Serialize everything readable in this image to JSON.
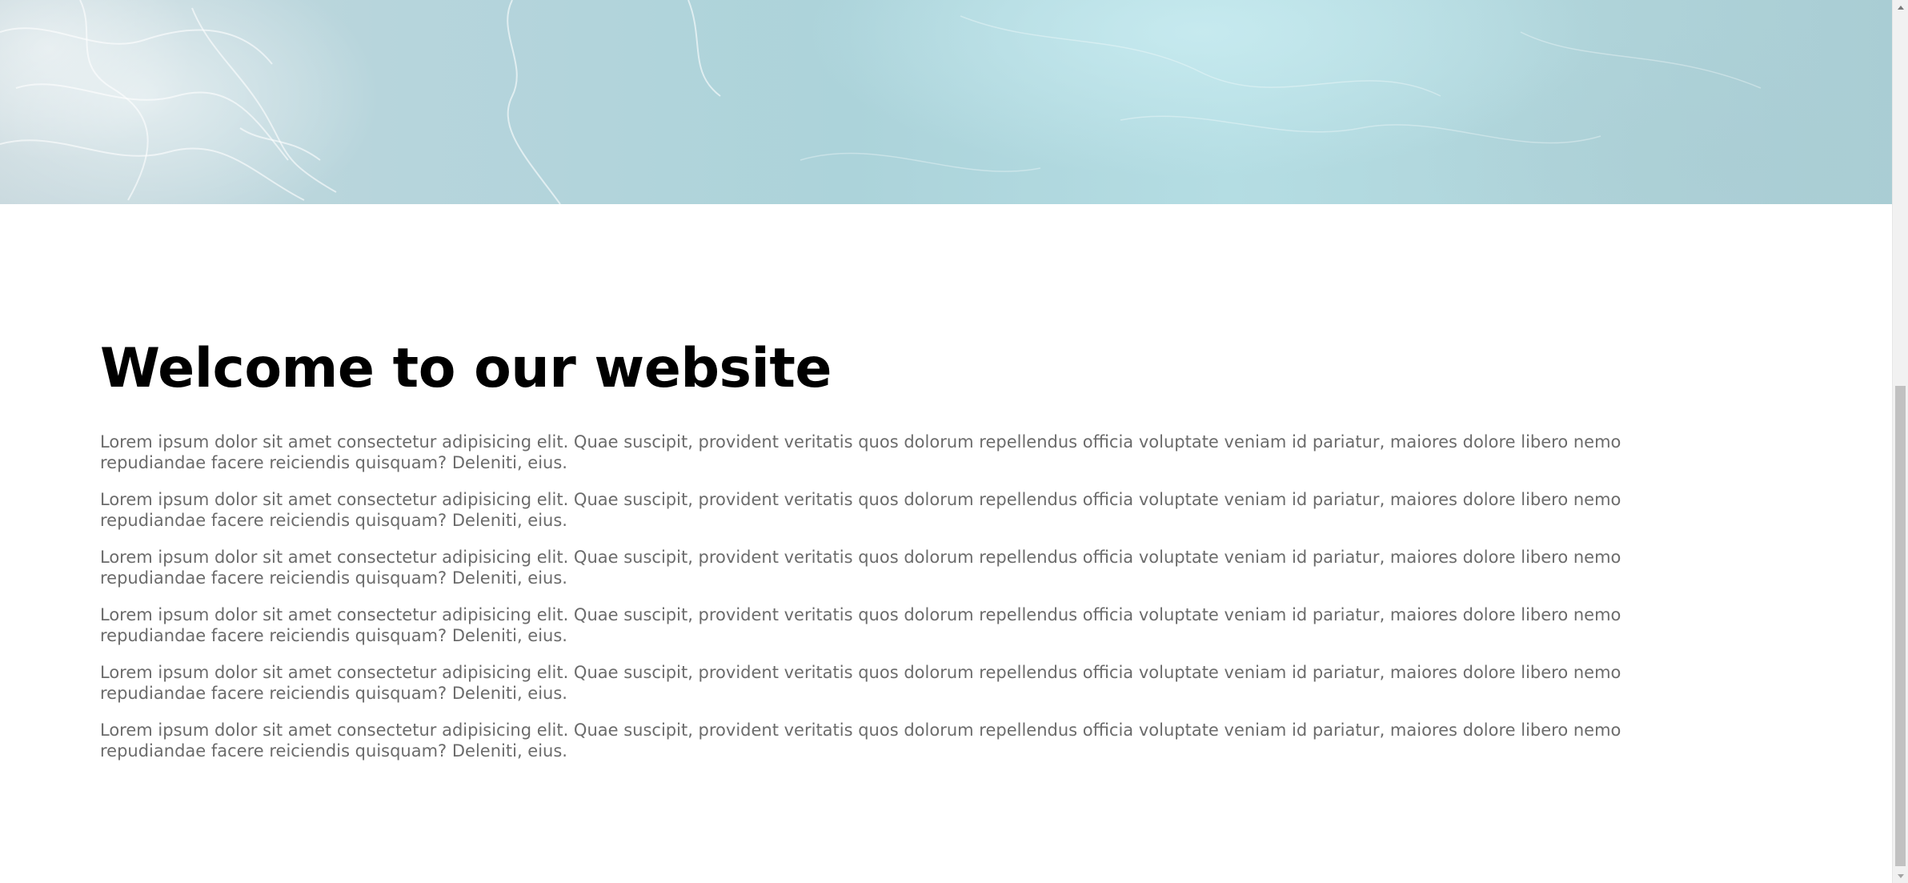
{
  "main": {
    "title": "Welcome to our website",
    "paragraphs": [
      "Lorem ipsum dolor sit amet consectetur adipisicing elit. Quae suscipit, provident veritatis quos dolorum repellendus officia voluptate veniam id pariatur, maiores dolore libero nemo repudiandae facere reiciendis quisquam? Deleniti, eius.",
      "Lorem ipsum dolor sit amet consectetur adipisicing elit. Quae suscipit, provident veritatis quos dolorum repellendus officia voluptate veniam id pariatur, maiores dolore libero nemo repudiandae facere reiciendis quisquam? Deleniti, eius.",
      "Lorem ipsum dolor sit amet consectetur adipisicing elit. Quae suscipit, provident veritatis quos dolorum repellendus officia voluptate veniam id pariatur, maiores dolore libero nemo repudiandae facere reiciendis quisquam? Deleniti, eius.",
      "Lorem ipsum dolor sit amet consectetur adipisicing elit. Quae suscipit, provident veritatis quos dolorum repellendus officia voluptate veniam id pariatur, maiores dolore libero nemo repudiandae facere reiciendis quisquam? Deleniti, eius.",
      "Lorem ipsum dolor sit amet consectetur adipisicing elit. Quae suscipit, provident veritatis quos dolorum repellendus officia voluptate veniam id pariatur, maiores dolore libero nemo repudiandae facere reiciendis quisquam? Deleniti, eius.",
      "Lorem ipsum dolor sit amet consectetur adipisicing elit. Quae suscipit, provident veritatis quos dolorum repellendus officia voluptate veniam id pariatur, maiores dolore libero nemo repudiandae facere reiciendis quisquam? Deleniti, eius."
    ]
  },
  "hero": {
    "image": "ocean-water-image"
  },
  "scrollbar": {
    "up_icon": "chevron-up-icon",
    "down_icon": "chevron-down-icon"
  },
  "colors": {
    "title": "#000000",
    "body_text": "#6b6b6b",
    "background": "#ffffff",
    "scroll_thumb": "#c1c1c1"
  }
}
